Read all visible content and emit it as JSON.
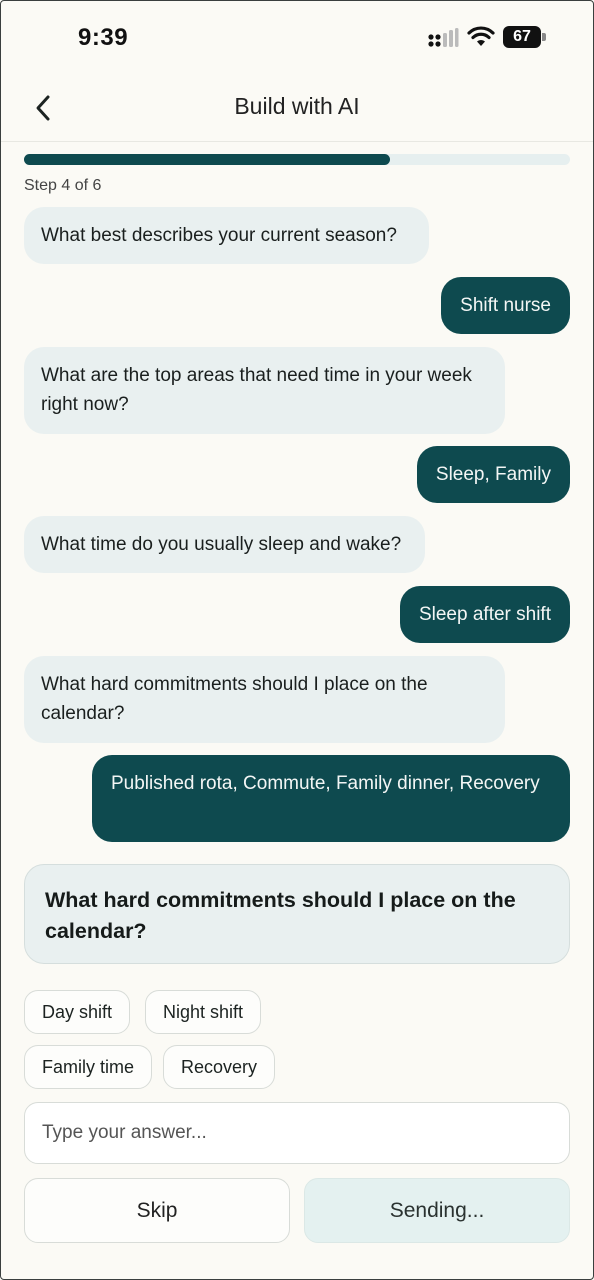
{
  "status_bar": {
    "time": "9:39",
    "battery_level": "67",
    "signal_icon": "cellular-signal-icon",
    "wifi_icon": "wifi-icon"
  },
  "header": {
    "title": "Build with AI",
    "back_icon": "chevron-left-icon"
  },
  "progress": {
    "step_label": "Step 4 of 6",
    "fraction": 0.67,
    "fill_color": "#0e4a4f",
    "track_color": "#e6efef"
  },
  "chat": [
    {
      "role": "assistant",
      "text": "What best describes your current season?"
    },
    {
      "role": "user",
      "text": "Shift nurse"
    },
    {
      "role": "assistant",
      "text": "What are the top areas that need time in your week right now?"
    },
    {
      "role": "user",
      "text": "Sleep, Family"
    },
    {
      "role": "assistant",
      "text": "What time do you usually sleep and wake?"
    },
    {
      "role": "user",
      "text": "Sleep after shift"
    },
    {
      "role": "assistant",
      "text": "What hard commitments should I place on the calendar?"
    },
    {
      "role": "user",
      "text": "Published rota, Commute, Family dinner, Recovery"
    }
  ],
  "current_question": "What hard commitments should I place on the calendar?",
  "suggestions": [
    "Day shift",
    "Night shift",
    "Family time",
    "Recovery"
  ],
  "input": {
    "placeholder": "Type your answer...",
    "value": ""
  },
  "actions": {
    "skip_label": "Skip",
    "send_label": "Sending..."
  },
  "colors": {
    "accent": "#0e4a4f",
    "bot_bubble": "#e9f0f0",
    "background": "#fbfaf5"
  }
}
